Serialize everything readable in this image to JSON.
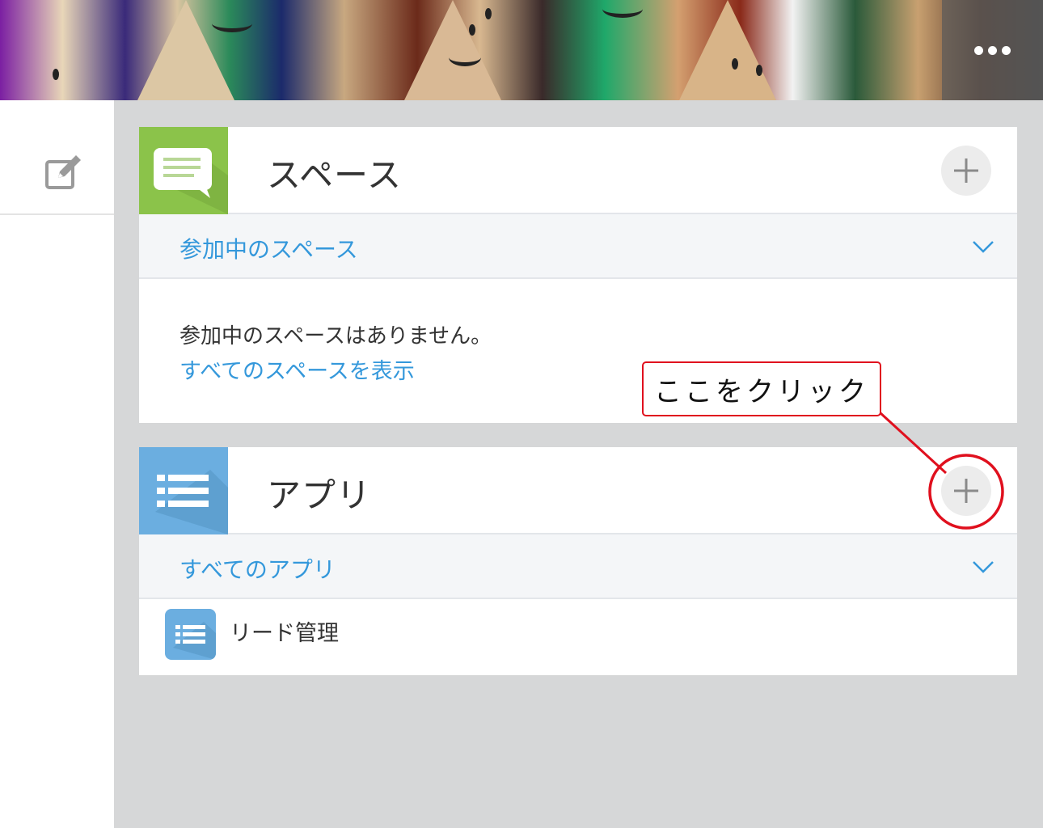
{
  "header": {
    "more_icon": "more-horizontal-icon"
  },
  "left_pane": {
    "edit_icon": "edit-icon"
  },
  "space_panel": {
    "title": "スペース",
    "icon": "speech-bubble-icon",
    "icon_color": "#8bc34a",
    "add_icon": "plus-icon",
    "filter_label": "参加中のスペース",
    "empty_message": "参加中のスペースはありません。",
    "show_all_link": "すべてのスペースを表示"
  },
  "app_panel": {
    "title": "アプリ",
    "icon": "list-icon",
    "icon_color": "#6baee0",
    "add_icon": "plus-icon",
    "filter_label": "すべてのアプリ",
    "apps": [
      {
        "name": "リード管理",
        "icon": "list-icon"
      }
    ]
  },
  "annotation": {
    "text": "ここをクリック",
    "color": "#e0101e"
  },
  "colors": {
    "link": "#3498db",
    "background": "#d6d7d8"
  }
}
